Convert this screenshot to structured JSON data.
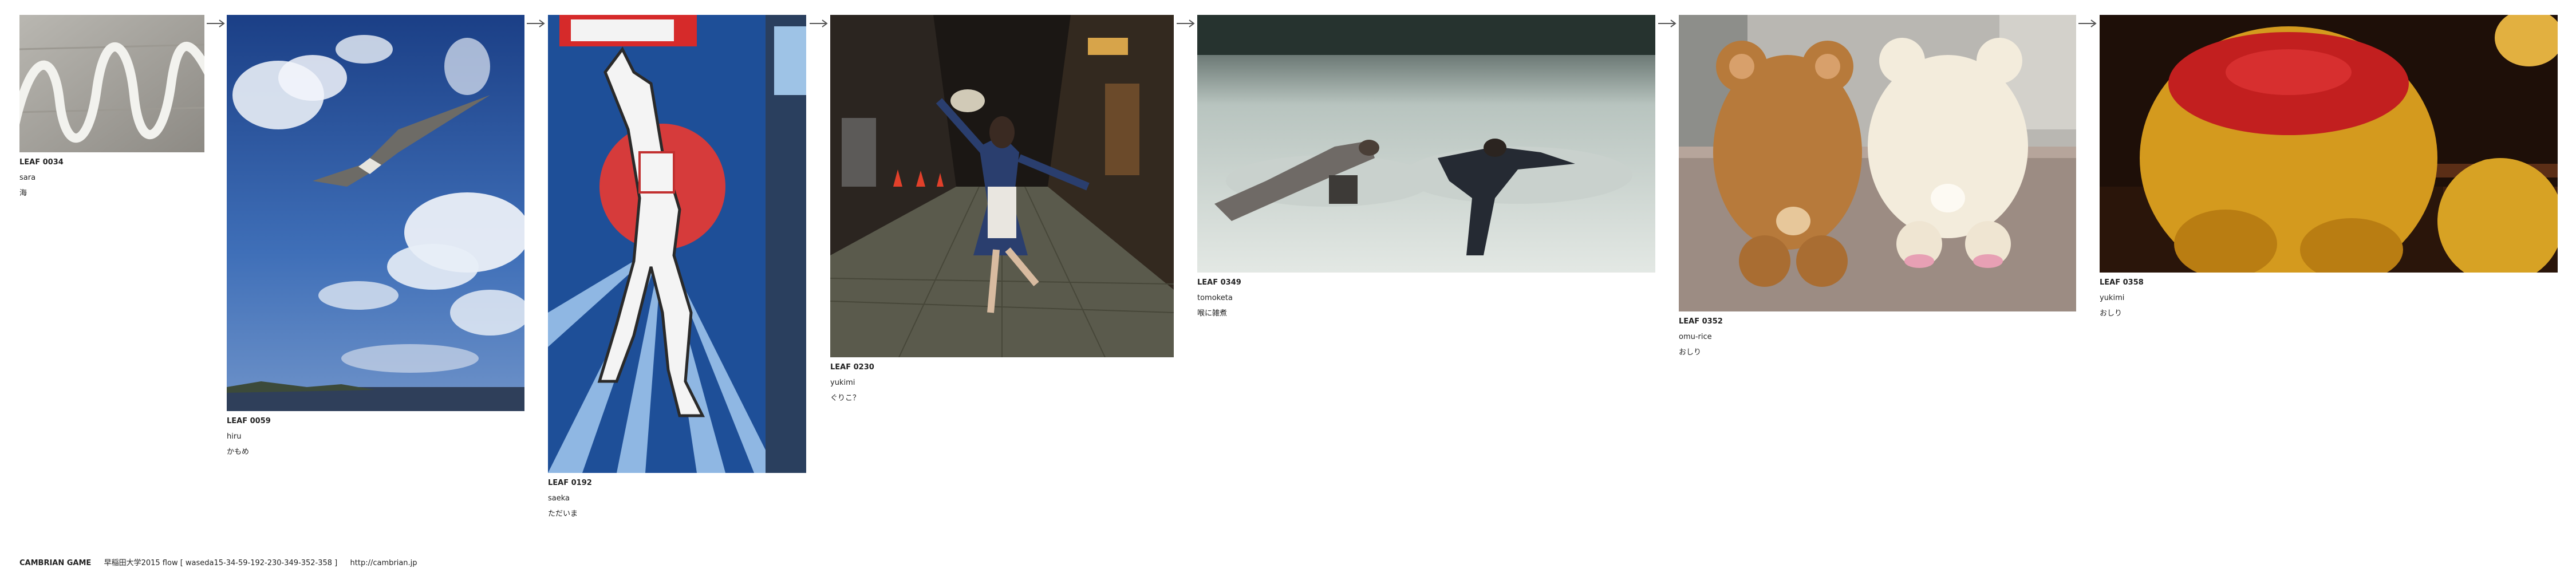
{
  "leaves": [
    {
      "id": "LEAF 0034",
      "user": "sara",
      "caption": "海",
      "photo_icon": "wall-wave-painting-photo"
    },
    {
      "id": "LEAF 0059",
      "user": "hiru",
      "caption": "かもめ",
      "photo_icon": "seagull-sky-photo"
    },
    {
      "id": "LEAF 0192",
      "user": "saeka",
      "caption": "ただいま",
      "photo_icon": "glico-runner-sign-photo"
    },
    {
      "id": "LEAF 0230",
      "user": "yukimi",
      "caption": "ぐりこ？",
      "photo_icon": "night-street-pose-photo"
    },
    {
      "id": "LEAF 0349",
      "user": "tomoketa",
      "caption": "喉に雑煮",
      "photo_icon": "snow-angels-photo"
    },
    {
      "id": "LEAF 0352",
      "user": "omu-rice",
      "caption": "おしり",
      "photo_icon": "bear-plushies-photo"
    },
    {
      "id": "LEAF 0358",
      "user": "yukimi",
      "caption": "おしり",
      "photo_icon": "pooh-plushie-photo"
    }
  ],
  "footer": {
    "brand": "CAMBRIAN GAME",
    "text": "早稲田大学2015  flow [ waseda15-34-59-192-230-349-352-358 ]",
    "url": "http://cambrian.jp"
  },
  "colors": {
    "text": "#222222",
    "arrow": "#555555",
    "background": "#ffffff"
  }
}
